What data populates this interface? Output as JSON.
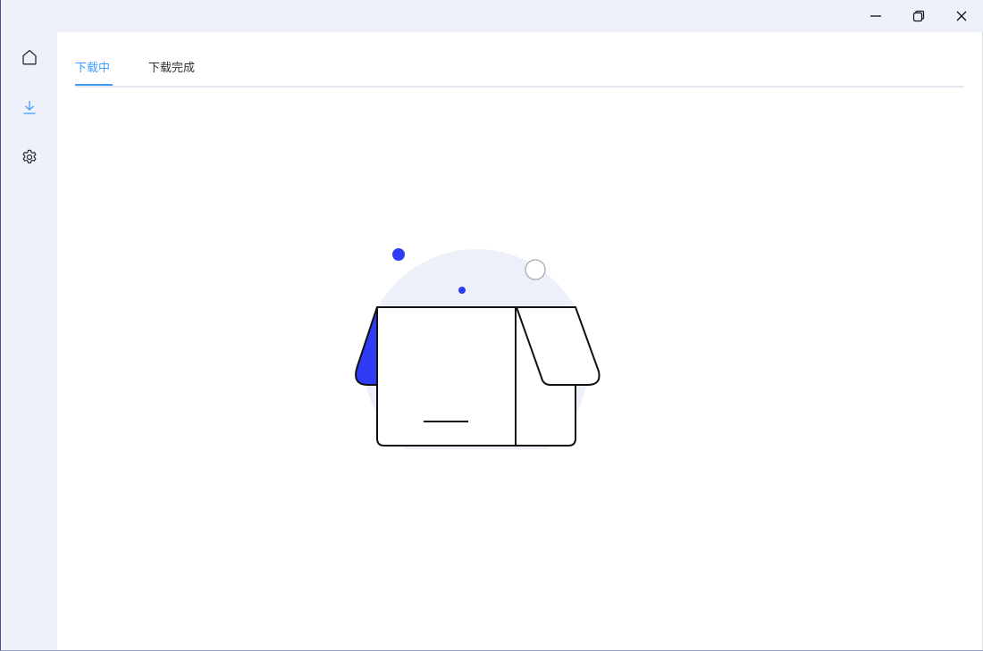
{
  "window": {
    "controls": [
      "minimize",
      "maximize",
      "close"
    ]
  },
  "sidebar": {
    "items": [
      {
        "name": "home",
        "icon": "home-icon"
      },
      {
        "name": "download",
        "icon": "download-icon",
        "active": true
      },
      {
        "name": "settings",
        "icon": "gear-icon"
      }
    ]
  },
  "tabs": {
    "items": [
      {
        "label": "下载中",
        "active": true
      },
      {
        "label": "下载完成",
        "active": false
      }
    ]
  },
  "empty_state": {
    "icon": "open-box-icon"
  },
  "colors": {
    "accent": "#409eff",
    "illustration_blue": "#2f3cf5",
    "sidebar_bg": "#eef1f9",
    "circle_bg": "#eef0f9"
  }
}
